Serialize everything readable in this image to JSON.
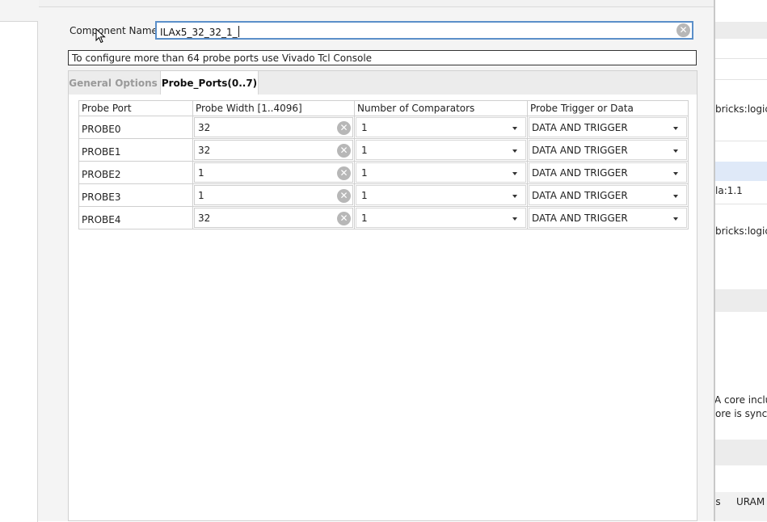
{
  "component": {
    "label": "Component Name",
    "value": "ILAx5_32_32_1_"
  },
  "info_text": "To configure more than 64 probe ports use Vivado Tcl Console",
  "tabs": [
    {
      "label": "General Options",
      "active": false
    },
    {
      "label": "Probe_Ports(0..7)",
      "active": true
    }
  ],
  "table": {
    "headers": [
      "Probe Port",
      "Probe Width [1..4096]",
      "Number of Comparators",
      "Probe Trigger or Data"
    ],
    "rows": [
      {
        "port": "PROBE0",
        "width": "32",
        "comparators": "1",
        "trigger": "DATA AND TRIGGER"
      },
      {
        "port": "PROBE1",
        "width": "32",
        "comparators": "1",
        "trigger": "DATA AND TRIGGER"
      },
      {
        "port": "PROBE2",
        "width": "1",
        "comparators": "1",
        "trigger": "DATA AND TRIGGER"
      },
      {
        "port": "PROBE3",
        "width": "1",
        "comparators": "1",
        "trigger": "DATA AND TRIGGER"
      },
      {
        "port": "PROBE4",
        "width": "32",
        "comparators": "1",
        "trigger": "DATA AND TRIGGER"
      }
    ]
  },
  "background_panel": {
    "line1": "bricks:logicv",
    "line2": "la:1.1",
    "line3": "bricks:logicv",
    "line4": "LA core inclu",
    "line5": "ore is synch",
    "col1": "ls",
    "col2": "URAM"
  },
  "colors": {
    "focus_border": "#5b8fc9",
    "selected_row": "#dfe9f8"
  },
  "icons": {
    "clear": "clear-circle-icon",
    "dropdown": "dropdown-arrow-icon",
    "cursor": "mouse-pointer-icon"
  }
}
